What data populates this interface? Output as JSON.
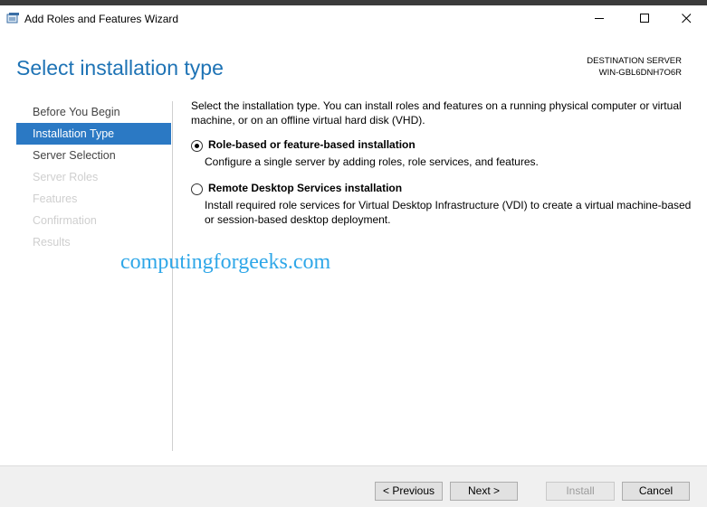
{
  "window": {
    "title": "Add Roles and Features Wizard"
  },
  "page": {
    "title": "Select installation type"
  },
  "destination": {
    "label": "DESTINATION SERVER",
    "server": "WIN-GBL6DNH7O6R"
  },
  "nav": {
    "items": [
      {
        "label": "Before You Begin",
        "state": "normal"
      },
      {
        "label": "Installation Type",
        "state": "selected"
      },
      {
        "label": "Server Selection",
        "state": "normal"
      },
      {
        "label": "Server Roles",
        "state": "disabled"
      },
      {
        "label": "Features",
        "state": "disabled"
      },
      {
        "label": "Confirmation",
        "state": "disabled"
      },
      {
        "label": "Results",
        "state": "disabled"
      }
    ]
  },
  "content": {
    "intro": "Select the installation type. You can install roles and features on a running physical computer or virtual machine, or on an offline virtual hard disk (VHD).",
    "options": [
      {
        "title": "Role-based or feature-based installation",
        "description": "Configure a single server by adding roles, role services, and features.",
        "selected": true
      },
      {
        "title": "Remote Desktop Services installation",
        "description": "Install required role services for Virtual Desktop Infrastructure (VDI) to create a virtual machine-based or session-based desktop deployment.",
        "selected": false
      }
    ]
  },
  "watermark": "computingforgeeks.com",
  "buttons": {
    "previous": "< Previous",
    "next": "Next >",
    "install": "Install",
    "cancel": "Cancel"
  },
  "colors": {
    "accent": "#1e73b5",
    "nav_selected": "#2b79c4",
    "watermark": "#2fa7e8"
  }
}
